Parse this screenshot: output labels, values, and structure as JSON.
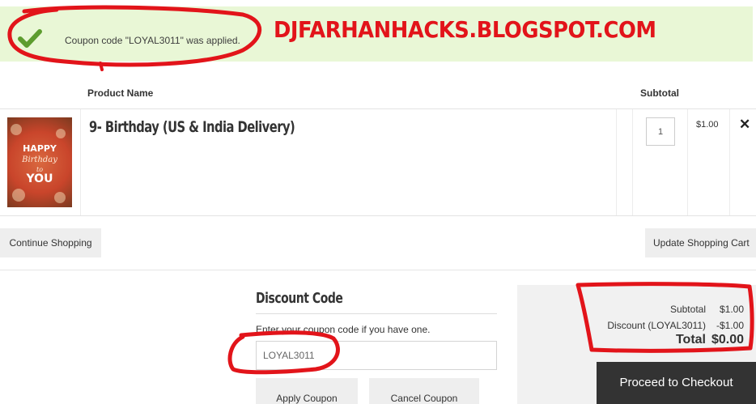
{
  "banner": {
    "message": "Coupon code \"LOYAL3011\" was applied.",
    "watermark": "DJFARHANHACKS.BLOGSPOT.COM",
    "icon": "checkmark-icon",
    "background_color": "#e9f7d6",
    "accent_color": "#5d9c2f"
  },
  "cart": {
    "headers": {
      "product_name": "Product Name",
      "subtotal": "Subtotal"
    },
    "items": [
      {
        "name": "9- Birthday (US & India Delivery)",
        "image_text": {
          "line1": "HAPPY",
          "line2": "Birthday",
          "line3": "to",
          "line4": "YOU"
        },
        "quantity": "1",
        "subtotal": "$1.00",
        "remove_icon": "close-icon"
      }
    ]
  },
  "actions": {
    "continue_shopping": "Continue Shopping",
    "update_cart": "Update Shopping Cart"
  },
  "discount": {
    "title": "Discount Code",
    "help_text": "Enter your coupon code if you have one.",
    "coupon_value": "LOYAL3011",
    "apply_label": "Apply Coupon",
    "cancel_label": "Cancel Coupon"
  },
  "totals": {
    "subtotal_label": "Subtotal",
    "subtotal_value": "$1.00",
    "discount_label": "Discount (LOYAL3011)",
    "discount_value": "-$1.00",
    "total_label": "Total",
    "total_value": "$0.00",
    "checkout_label": "Proceed to Checkout"
  },
  "colors": {
    "annotation_red": "#e2141a",
    "checkout_button": "#333333",
    "totals_background": "#f1f1f1"
  }
}
